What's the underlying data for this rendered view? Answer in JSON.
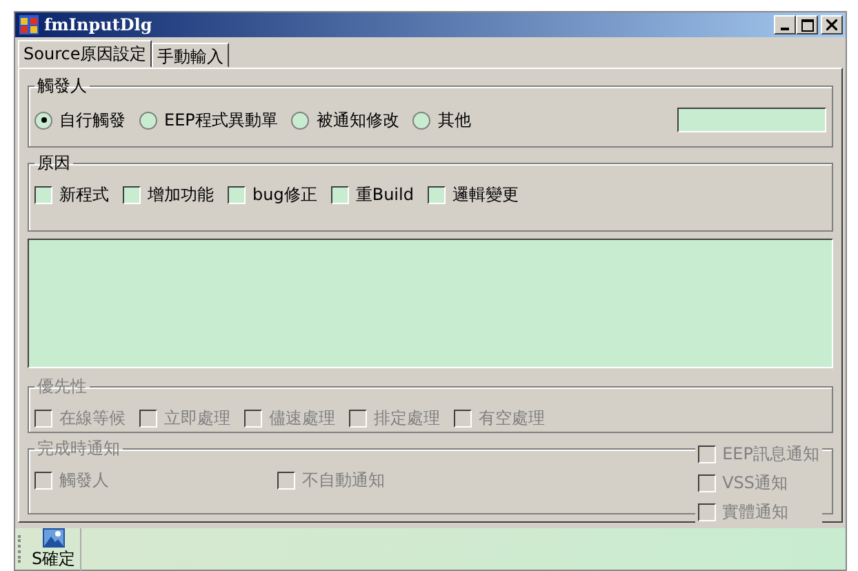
{
  "window": {
    "title": "fmInputDlg"
  },
  "tabs": [
    {
      "label": "Source原因設定",
      "selected": true
    },
    {
      "label": "手動輸入",
      "selected": false
    }
  ],
  "trigger_group": {
    "title": "觸發人",
    "options": [
      {
        "label": "自行觸發",
        "selected": true
      },
      {
        "label": "EEP程式異動單",
        "selected": false
      },
      {
        "label": "被通知修改",
        "selected": false
      },
      {
        "label": "其他",
        "selected": false
      }
    ]
  },
  "reason_group": {
    "title": "原因",
    "options": [
      {
        "label": "新程式",
        "checked": false,
        "disabled": false
      },
      {
        "label": "增加功能",
        "checked": false,
        "disabled": false
      },
      {
        "label": "bug修正",
        "checked": false,
        "disabled": false
      },
      {
        "label": "重Build",
        "checked": false,
        "disabled": false
      },
      {
        "label": "邏輯變更",
        "checked": false,
        "disabled": false
      }
    ]
  },
  "priority_group": {
    "title": "優先性",
    "options": [
      {
        "label": "在線等候",
        "checked": false,
        "disabled": true
      },
      {
        "label": "立即處理",
        "checked": false,
        "disabled": true
      },
      {
        "label": "儘速處理",
        "checked": false,
        "disabled": true
      },
      {
        "label": "排定處理",
        "checked": false,
        "disabled": true
      },
      {
        "label": "有空處理",
        "checked": false,
        "disabled": true
      }
    ]
  },
  "notify_group": {
    "title": "完成時通知",
    "left_options": [
      {
        "label": "觸發人",
        "checked": false,
        "disabled": true
      },
      {
        "label": "不自動通知",
        "checked": false,
        "disabled": true
      }
    ],
    "right_options": [
      {
        "label": "EEP訊息通知",
        "checked": false,
        "disabled": true
      },
      {
        "label": "VSS通知",
        "checked": false,
        "disabled": true
      },
      {
        "label": "實體通知",
        "checked": false,
        "disabled": true
      }
    ]
  },
  "toolbar": {
    "buttons": [
      {
        "label": "S確定"
      }
    ]
  }
}
